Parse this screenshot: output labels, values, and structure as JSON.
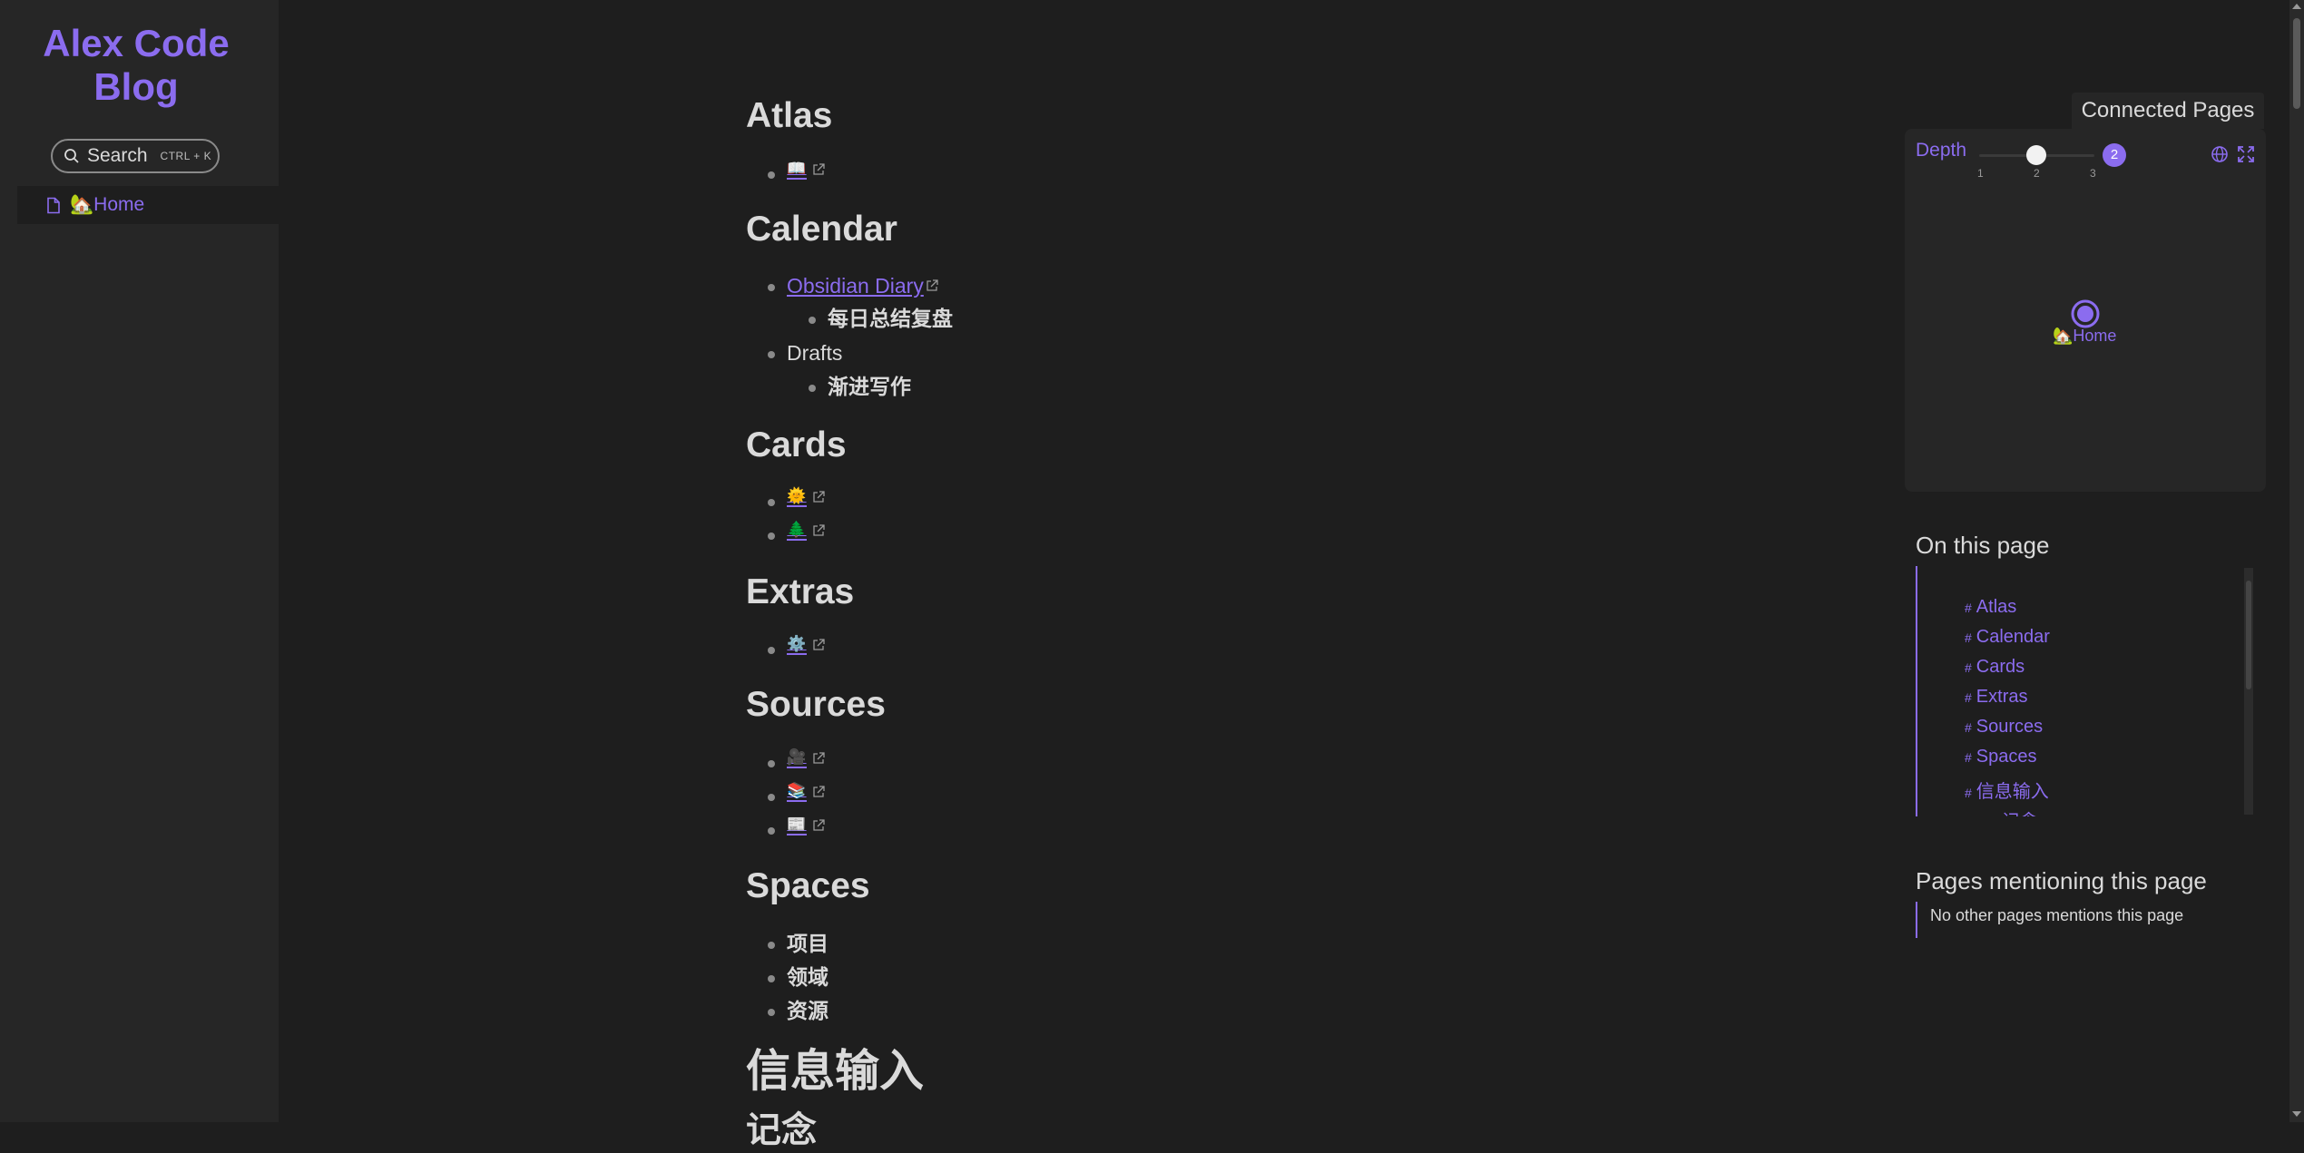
{
  "site": {
    "title": "Alex Code Blog"
  },
  "search": {
    "label": "Search",
    "shortcut": "CTRL + K"
  },
  "nav": {
    "home_label": "🏡Home"
  },
  "content": {
    "sections": {
      "atlas": "Atlas",
      "calendar": "Calendar",
      "cards": "Cards",
      "extras": "Extras",
      "sources": "Sources",
      "spaces": "Spaces",
      "info": "信息输入",
      "next": "记念"
    },
    "atlas_items": [
      "📖"
    ],
    "calendar_items": {
      "diary": "Obsidian Diary",
      "diary_sub": "每日总结复盘",
      "drafts": "Drafts",
      "drafts_sub": "渐进写作"
    },
    "cards_items": [
      "🌞",
      "🌲"
    ],
    "extras_items": [
      "⚙️"
    ],
    "sources_items": [
      "🎥",
      "📚",
      "📰"
    ],
    "spaces_items": [
      "项目",
      "领域",
      "资源"
    ]
  },
  "graph": {
    "title": "Connected Pages",
    "depth_label": "Depth",
    "depth_ticks": [
      "1",
      "2",
      "3"
    ],
    "depth_value": "2",
    "node_label": "🏡Home",
    "icons": [
      "globe-icon",
      "expand-icon"
    ]
  },
  "toc": {
    "title": "On this page",
    "items": [
      "Atlas",
      "Calendar",
      "Cards",
      "Extras",
      "Sources",
      "Spaces",
      "信息输入",
      "记念"
    ],
    "hash": "#"
  },
  "backlinks": {
    "title": "Pages mentioning this page",
    "empty_text": "No other pages mentions this page"
  },
  "colors": {
    "accent": "#8b6cef",
    "background": "#1e1e1e",
    "sidebar": "#262626",
    "text": "#dadada"
  }
}
